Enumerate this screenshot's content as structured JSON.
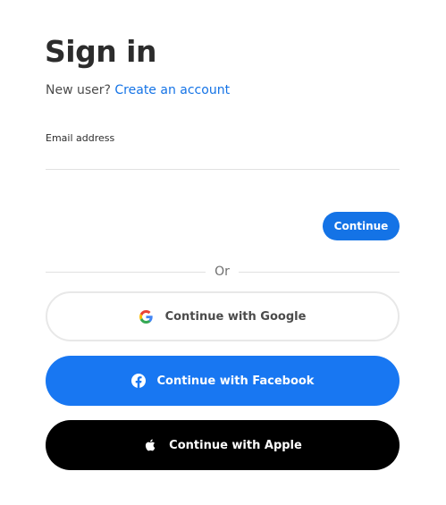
{
  "header": {
    "title": "Sign in",
    "new_user_text": "New user?",
    "create_account_link": "Create an account"
  },
  "email": {
    "label": "Email address",
    "value": "",
    "placeholder": ""
  },
  "actions": {
    "continue_label": "Continue",
    "divider_text": "Or"
  },
  "social": {
    "google_label": "Continue with Google",
    "facebook_label": "Continue with Facebook",
    "apple_label": "Continue with Apple"
  },
  "colors": {
    "accent": "#1473e6",
    "facebook": "#1877f2",
    "apple": "#000000"
  },
  "icons": {
    "google": "google-icon",
    "facebook": "facebook-icon",
    "apple": "apple-icon"
  }
}
